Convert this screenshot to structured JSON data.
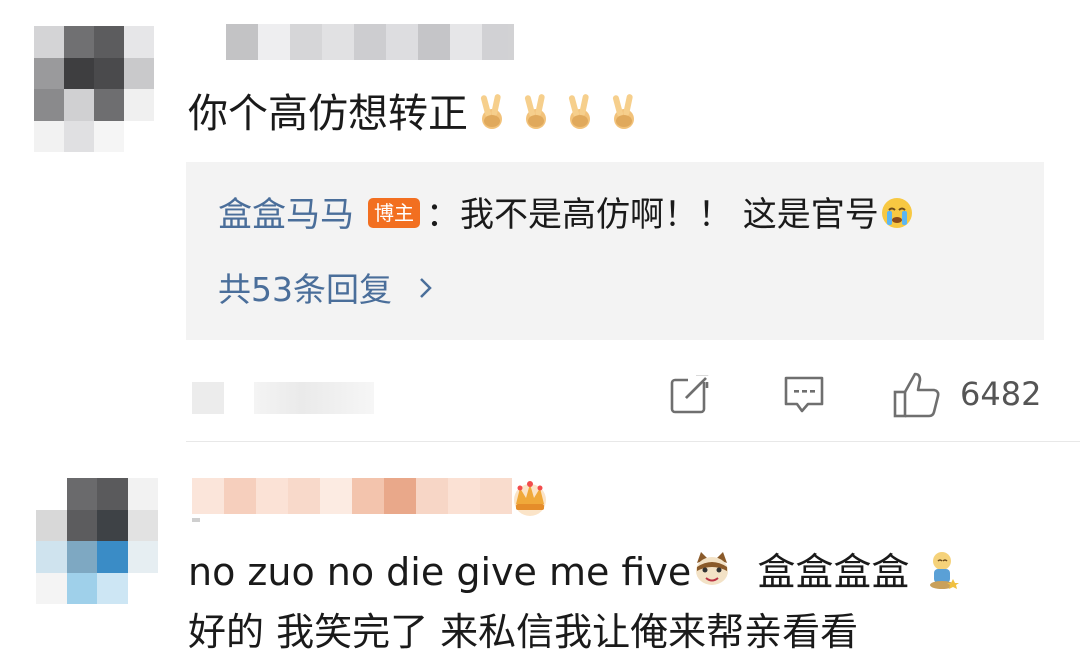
{
  "comment1": {
    "text": "你个高仿想转正",
    "emojis": [
      "peace-hand-emoji",
      "peace-hand-emoji",
      "peace-hand-emoji",
      "peace-hand-emoji"
    ],
    "reply": {
      "author": "盒盒马马",
      "badge": "博主",
      "separator": "：",
      "text": "我不是高仿啊！！ 这是官号",
      "emoji": "crying-face-emoji",
      "count_label": "共53条回复",
      "chevron": "›"
    },
    "actions": {
      "share_icon": "share-icon",
      "comment_icon": "comment-icon",
      "like_icon": "thumbs-up-icon",
      "like_count": "6482"
    }
  },
  "comment2": {
    "line1_text": "no zuo no die give me five",
    "line1_emoji1": "cat-face-emoji",
    "line1_text2": "  盒盒盒盒 ",
    "line1_emoji2": "doge-figure-emoji",
    "line2_text": "好的 我笑完了 来私信我让俺来帮亲看看"
  },
  "colors": {
    "link_blue": "#4a6e9a",
    "badge_orange": "#f26f20",
    "reply_bg": "#f3f3f3",
    "text": "#1a1a1a",
    "muted": "#555555"
  }
}
